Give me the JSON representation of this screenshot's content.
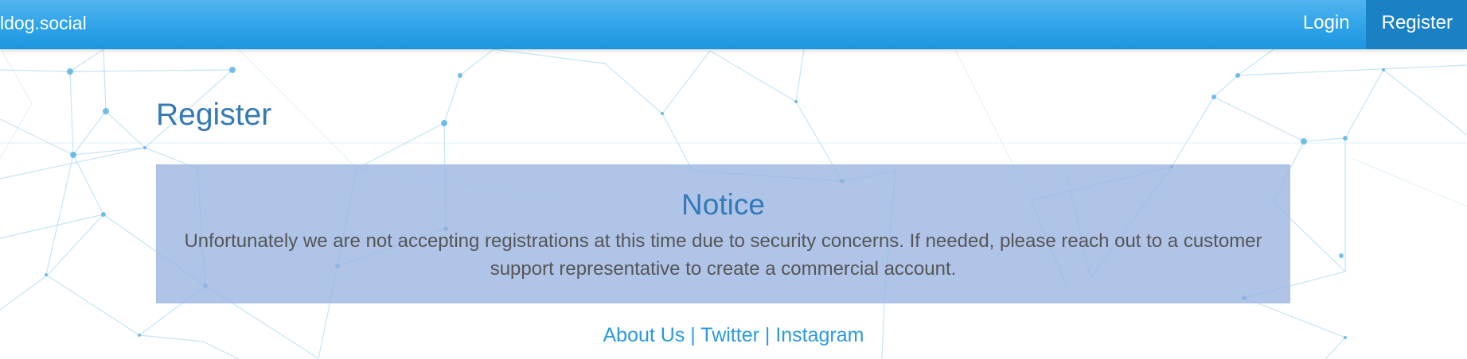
{
  "navbar": {
    "brand": "ldog.social",
    "login_label": "Login",
    "register_label": "Register"
  },
  "main": {
    "page_title": "Register",
    "notice": {
      "title": "Notice",
      "message": "Unfortunately we are not accepting registrations at this time due to security concerns. If needed, please reach out to a customer support representative to create a commercial account."
    }
  },
  "footer": {
    "links": [
      "About Us",
      "Twitter",
      "Instagram"
    ],
    "separator": "|"
  },
  "colors": {
    "navbar": "#34a6ea",
    "navbar_active": "#1a82c4",
    "title": "#337ab7",
    "notice_background": "#9ab4e2",
    "link": "#2a9ae0",
    "body_text": "#555555"
  }
}
